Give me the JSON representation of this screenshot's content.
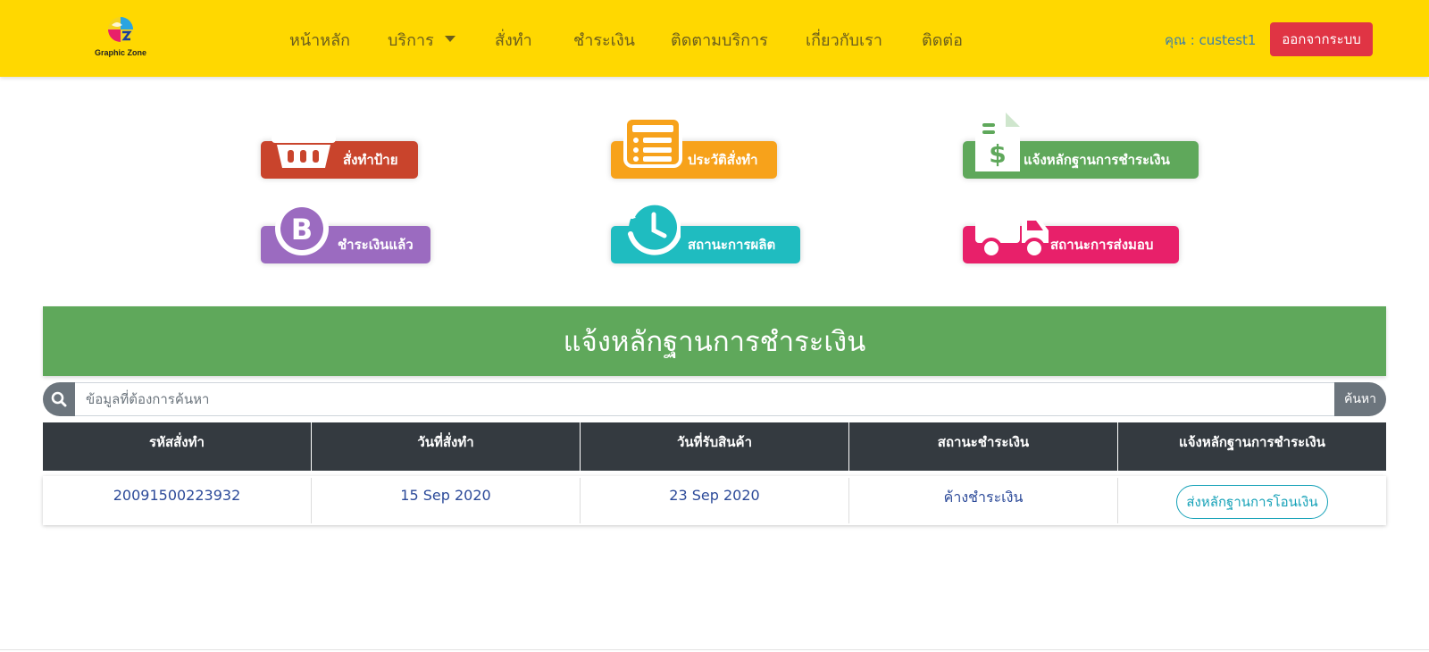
{
  "brand": {
    "name": "Graphic Zone"
  },
  "nav": {
    "items": [
      {
        "label": "หน้าหลัก",
        "icon": null
      },
      {
        "label": "บริการ",
        "icon": "caret-down-icon"
      },
      {
        "label": "สั่งทำ",
        "icon": null
      },
      {
        "label": "ชำระเงิน",
        "icon": null
      },
      {
        "label": "ติดตามบริการ",
        "icon": null
      },
      {
        "label": "เกี่ยวกับเรา",
        "icon": null
      },
      {
        "label": "ติดต่อ",
        "icon": null
      }
    ],
    "user_label": "คุณ : custest1",
    "logout_label": "ออกจากระบบ"
  },
  "menu": {
    "tiles": [
      {
        "label": "สั่งทำป้าย",
        "icon": "basket-icon",
        "color": "#c9442c"
      },
      {
        "label": "ประวัติสั่งทำ",
        "icon": "order-list-icon",
        "color": "#f7a21b"
      },
      {
        "label": "แจ้งหลักฐานการชำระเงิน",
        "icon": "invoice-dollar-icon",
        "color": "#5fa85b"
      },
      {
        "label": "ชำระเงินแล้ว",
        "icon": "bitcoin-icon",
        "color": "#9b6bc0"
      },
      {
        "label": "สถานะการผลิต",
        "icon": "history-clock-icon",
        "color": "#1fbcc0"
      },
      {
        "label": "สถานะการส่งมอบ",
        "icon": "delivery-truck-icon",
        "color": "#e8206a"
      }
    ]
  },
  "panel": {
    "title": "แจ้งหลักฐานการชำระเงิน"
  },
  "search": {
    "placeholder": "ข้อมูลที่ต้องการค้นหา",
    "value": "",
    "button_label": "ค้นหา"
  },
  "table": {
    "headers": [
      "รหัสสั่งทำ",
      "วันที่สั่งทำ",
      "วันที่รับสินค้า",
      "สถานะชำระเงิน",
      "แจ้งหลักฐานการชำระเงิน"
    ],
    "rows": [
      {
        "order_id": "20091500223932",
        "order_date": "15 Sep 2020",
        "receive_date": "23 Sep 2020",
        "payment_status": "ค้างชำระเงิน",
        "action_label": "ส่งหลักฐานการโอนเงิน"
      }
    ]
  }
}
